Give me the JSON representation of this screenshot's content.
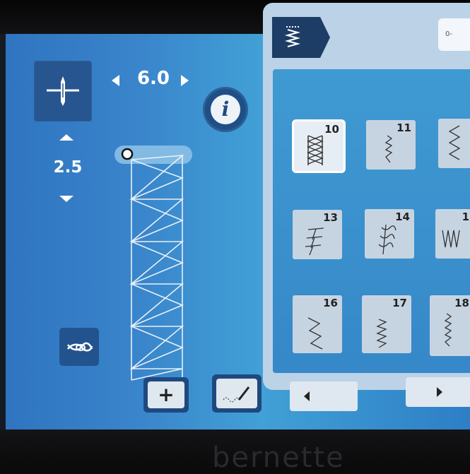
{
  "device": {
    "brand": "bernette"
  },
  "settings": {
    "stitch_width": "6.0",
    "stitch_length": "2.5"
  },
  "info_button": {
    "label": "i"
  },
  "buttons": {
    "plus": "+"
  },
  "category": {
    "range_label": "0-"
  },
  "stitches": [
    {
      "number": "10",
      "selected": true
    },
    {
      "number": "11"
    },
    {
      "number": ""
    },
    {
      "number": "13"
    },
    {
      "number": "14"
    },
    {
      "number": "1"
    },
    {
      "number": "16"
    },
    {
      "number": "17"
    },
    {
      "number": "18"
    }
  ],
  "icons": {
    "needle_position": "needle-center-icon",
    "tie_off": "tie-off-knot-icon",
    "category": "stitch-category-icon",
    "draw": "freehand-draw-icon"
  },
  "colors": {
    "screen_blue": "#3a86cc",
    "panel_bg": "#bcd2e6",
    "tile_dark": "#27558f"
  }
}
